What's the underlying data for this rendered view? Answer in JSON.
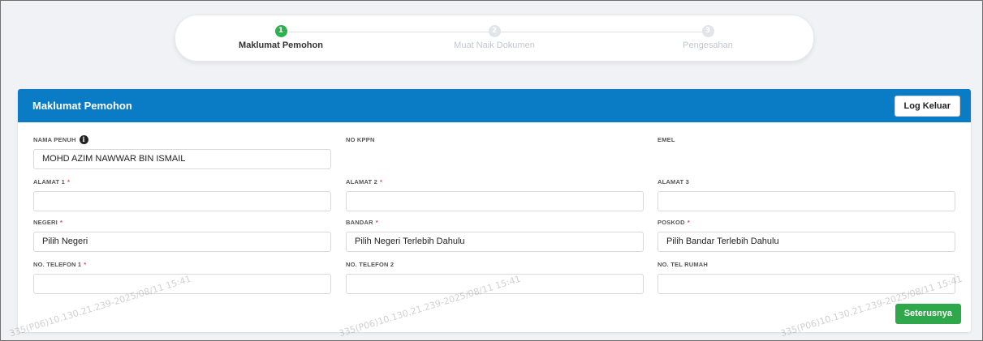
{
  "stepper": {
    "steps": [
      {
        "number": "1",
        "label": "Maklumat Pemohon",
        "active": true
      },
      {
        "number": "2",
        "label": "Muat Naik Dokumen",
        "active": false
      },
      {
        "number": "3",
        "label": "Pengesahan",
        "active": false
      }
    ]
  },
  "card": {
    "title": "Maklumat Pemohon",
    "logout_label": "Log Keluar",
    "next_label": "Seterusnya"
  },
  "form": {
    "nama_penuh": {
      "label": "NAMA PENUH",
      "value": "MOHD AZIM NAWWAR BIN ISMAIL",
      "info_icon": "i"
    },
    "no_kppn": {
      "label": "NO KPPN",
      "value": ""
    },
    "emel": {
      "label": "EMEL",
      "value": ""
    },
    "alamat1": {
      "label": "ALAMAT 1",
      "required": "*",
      "value": ""
    },
    "alamat2": {
      "label": "ALAMAT 2",
      "required": "*",
      "value": ""
    },
    "alamat3": {
      "label": "ALAMAT 3",
      "value": ""
    },
    "negeri": {
      "label": "NEGERI",
      "required": "*",
      "value": "Pilih Negeri"
    },
    "bandar": {
      "label": "BANDAR",
      "required": "*",
      "value": "Pilih Negeri Terlebih Dahulu"
    },
    "poskod": {
      "label": "POSKOD",
      "required": "*",
      "value": "Pilih Bandar Terlebih Dahulu"
    },
    "telefon1": {
      "label": "NO. TELEFON 1",
      "required": "*",
      "value": ""
    },
    "telefon2": {
      "label": "NO. TELEFON 2",
      "value": ""
    },
    "tel_rumah": {
      "label": "NO. TEL RUMAH",
      "value": ""
    }
  },
  "watermark": {
    "text": "335(P06)10.130.21.239-2025/08/11 15:41"
  },
  "colors": {
    "header": "#0a7bc5",
    "active_step": "#2db14c",
    "next_button": "#2fa84b",
    "required": "#e0474c"
  }
}
